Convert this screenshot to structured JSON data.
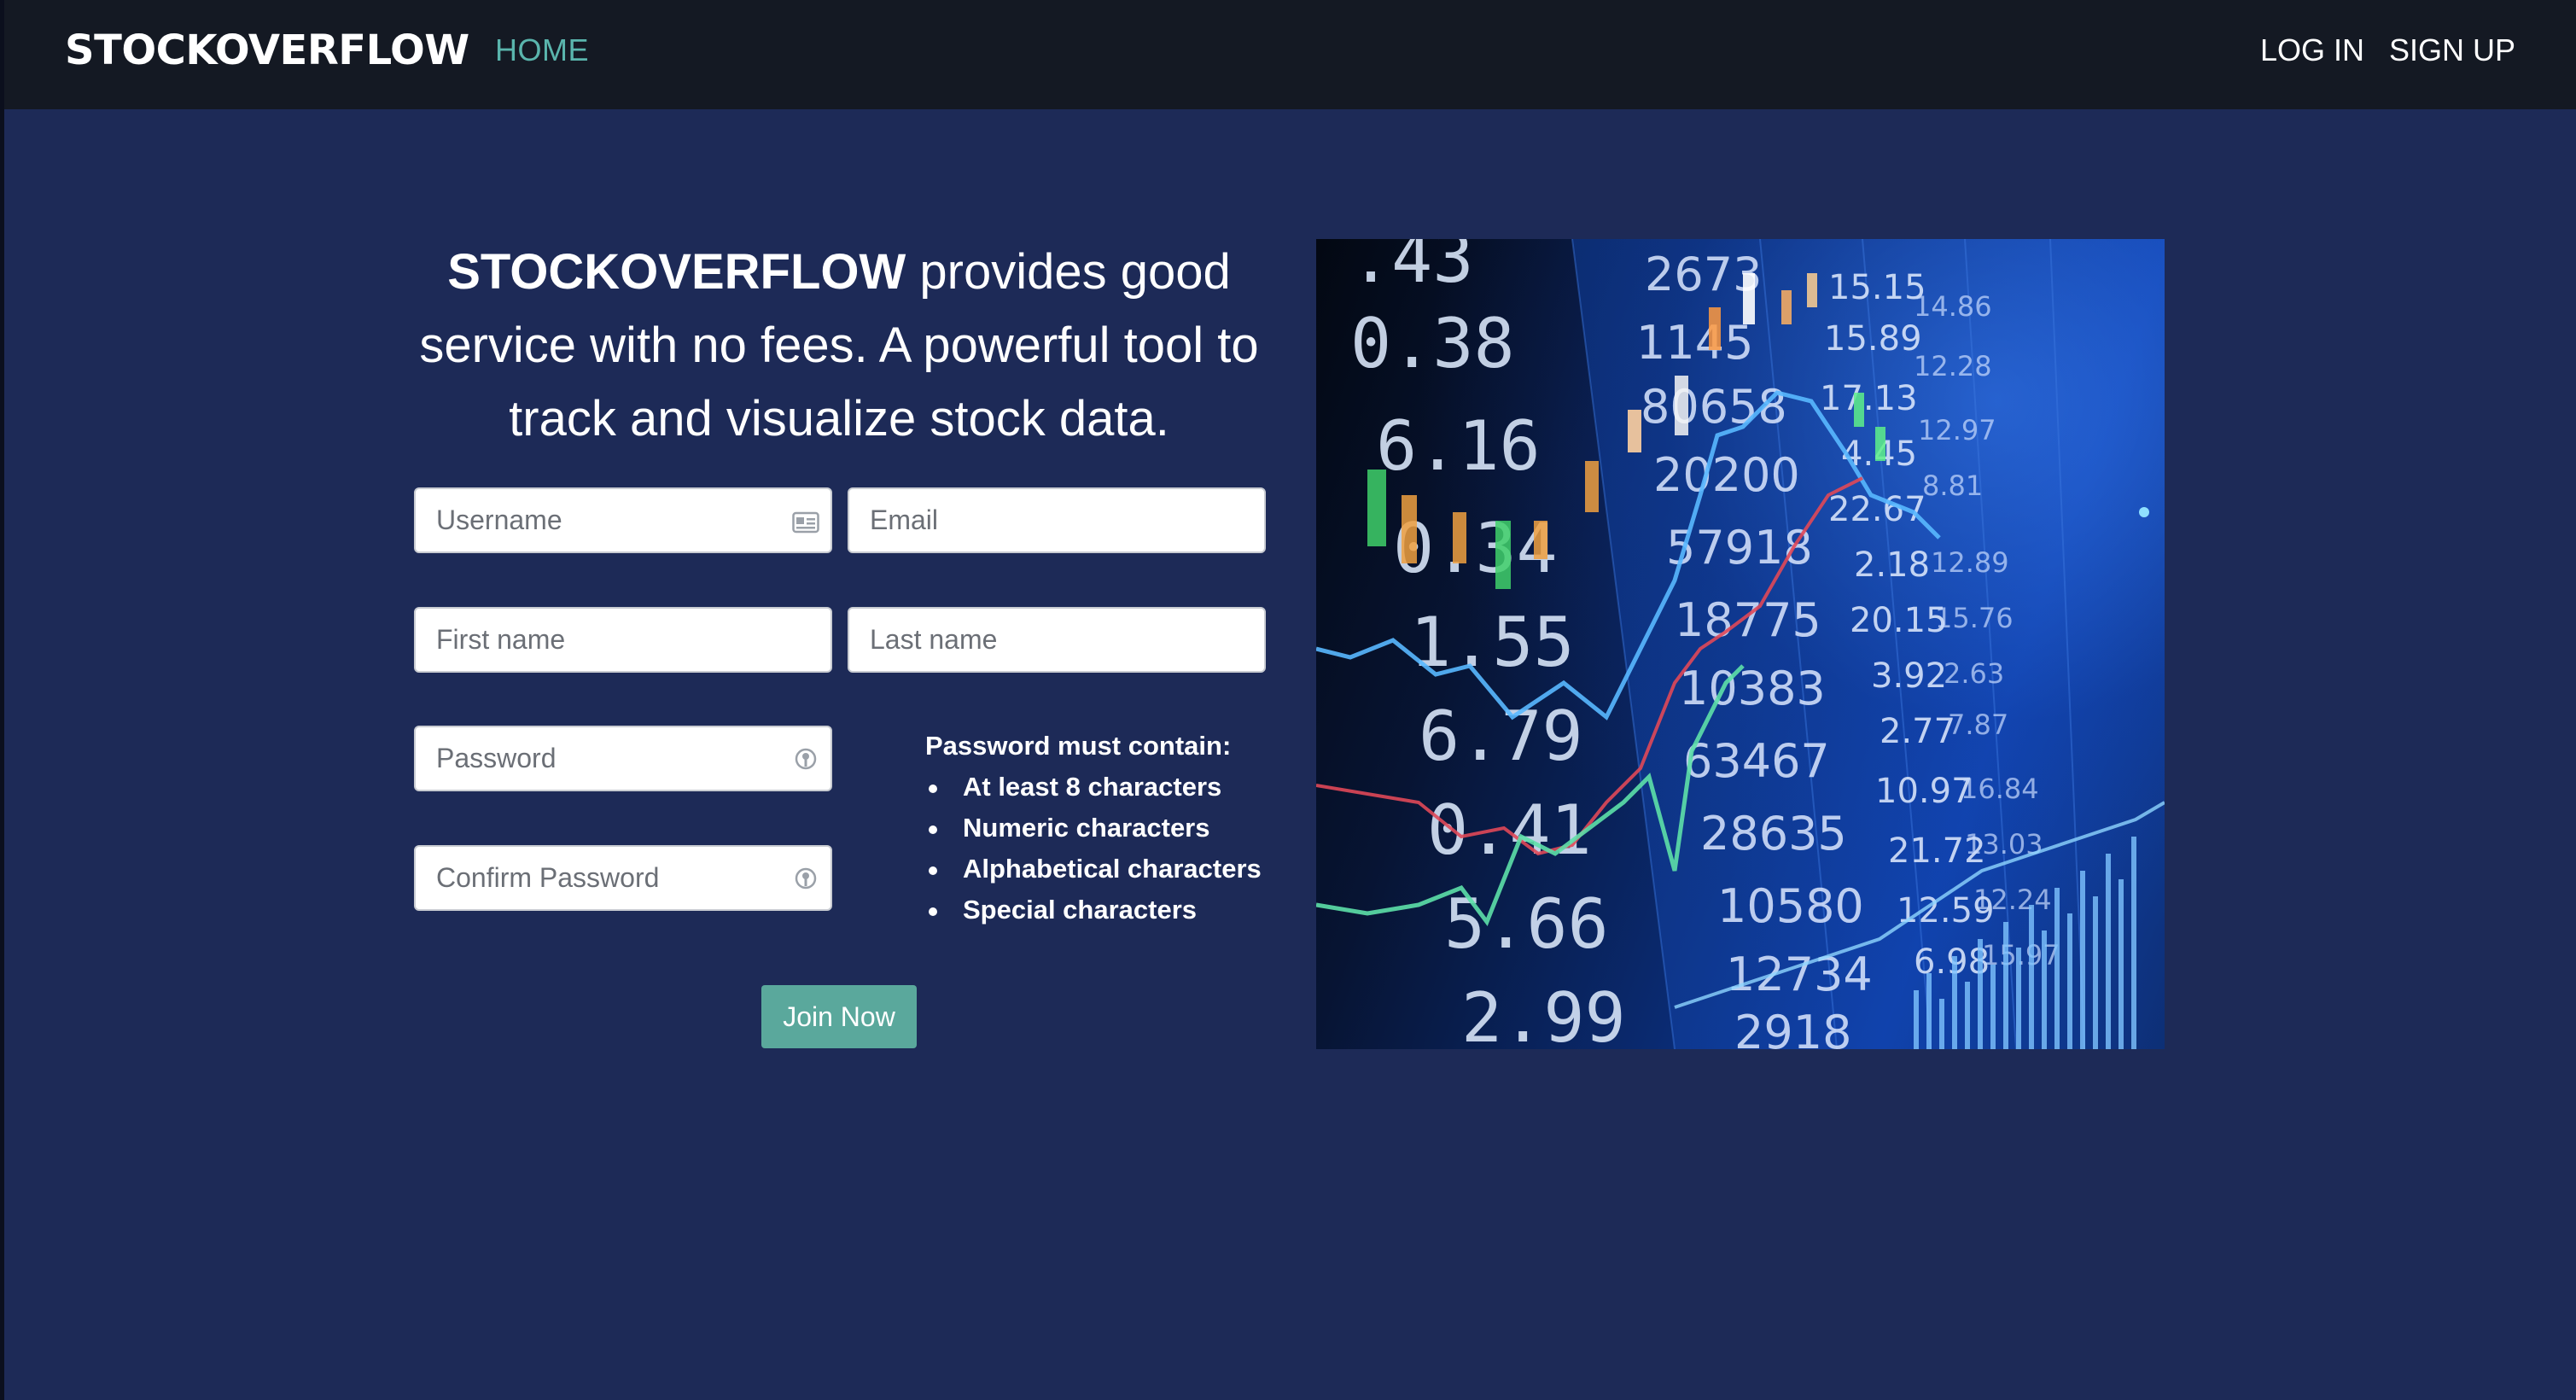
{
  "navbar": {
    "brand": "STOCKOVERFLOW",
    "home": "HOME",
    "login": "LOG IN",
    "signup": "SIGN UP"
  },
  "tagline": {
    "brand": "STOCKOVERFLOW",
    "text": " provides good service with no fees. A powerful tool to track and visualize stock data."
  },
  "form": {
    "username_placeholder": "Username",
    "email_placeholder": "Email",
    "firstname_placeholder": "First name",
    "lastname_placeholder": "Last name",
    "password_placeholder": "Password",
    "confirm_placeholder": "Confirm Password",
    "submit_label": "Join Now"
  },
  "requirements": {
    "title": "Password must contain:",
    "items": [
      "At least 8 characters",
      "Numeric characters",
      "Alphabetical characters",
      "Special characters"
    ]
  },
  "image": {
    "numbers_left": ".43",
    "n2": "0.38",
    "n3": "6.16",
    "n4": "0.34",
    "n5": "1.55",
    "n6": "6.79",
    "n7": "0.41",
    "n8": "5.66",
    "n9": "2.99",
    "mid": [
      "2673",
      "1145",
      "80658",
      "20200",
      "57918",
      "18775",
      "10383",
      "63467",
      "28635",
      "10580",
      "12734",
      "2918"
    ],
    "right": [
      "15.15",
      "15.89",
      "17.13",
      "4.45",
      "22.67",
      "2.18",
      "20.15",
      "3.92",
      "2.77",
      "10.97",
      "21.72",
      "12.59",
      "6.98"
    ],
    "far": [
      "14.86",
      "12.28",
      "12.97",
      "8.81",
      "12.89",
      "15.76",
      "2.63",
      "7.87",
      "16.84",
      "13.03",
      "12.24",
      "15.97"
    ]
  },
  "colors": {
    "accent": "#5ab5ad",
    "button": "#5aa89c",
    "background": "#1d2a57",
    "navbar": "#141923"
  }
}
